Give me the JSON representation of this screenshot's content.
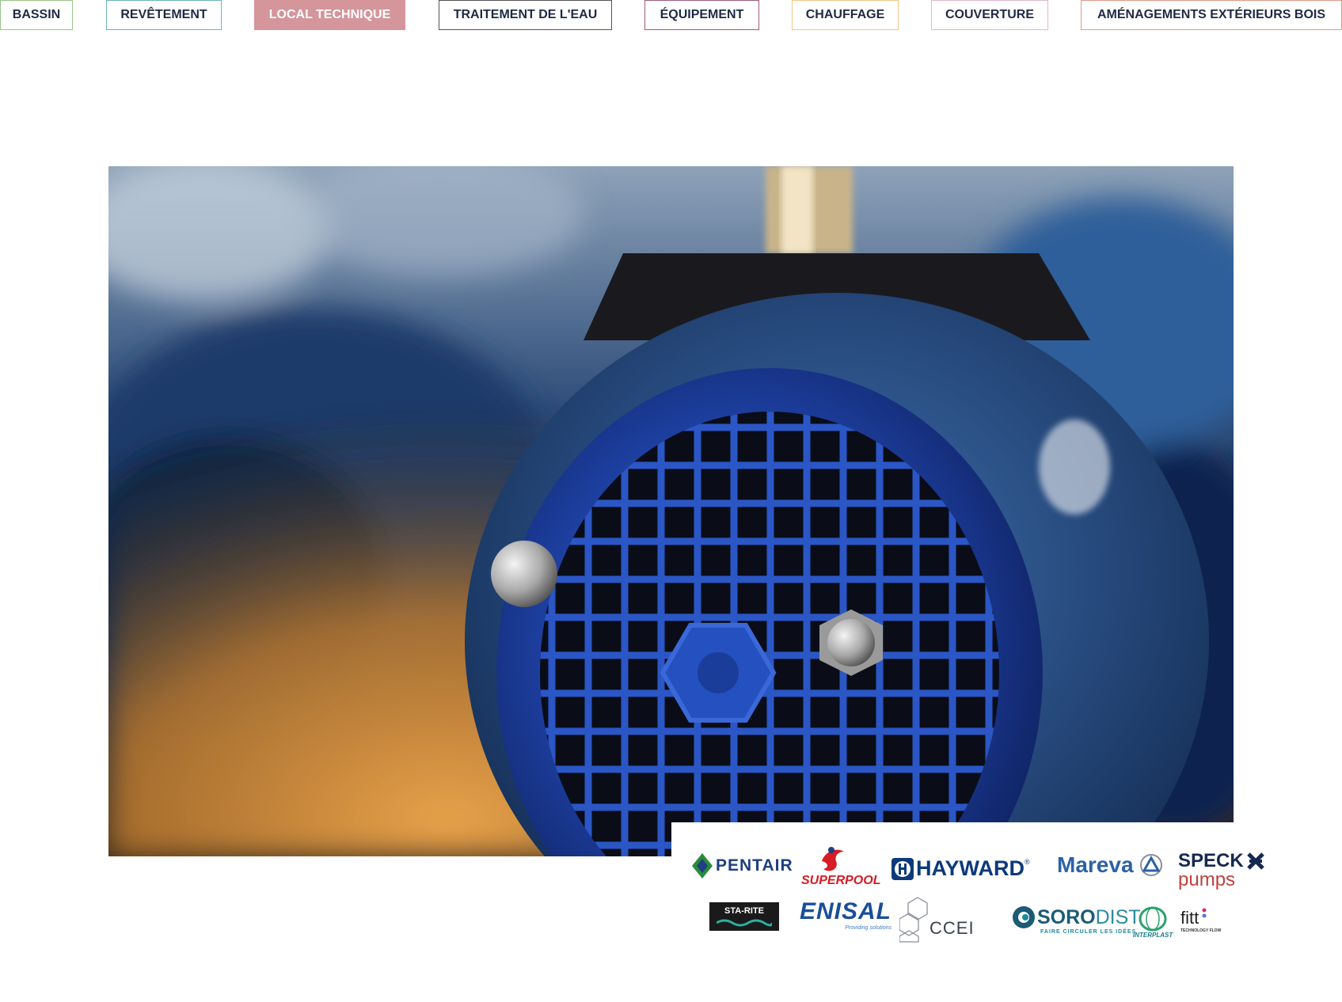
{
  "nav": {
    "tabs": [
      {
        "label": "BASSIN",
        "color": "#9ac48a",
        "active": false
      },
      {
        "label": "REVÊTEMENT",
        "color": "#6ab6c0",
        "active": false
      },
      {
        "label": "LOCAL TECHNIQUE",
        "color": "#d4959b",
        "active": true
      },
      {
        "label": "TRAITEMENT DE L'EAU",
        "color": "#555555",
        "active": false
      },
      {
        "label": "ÉQUIPEMENT",
        "color": "#a05a7a",
        "active": false
      },
      {
        "label": "CHAUFFAGE",
        "color": "#f0c888",
        "active": false
      },
      {
        "label": "COUVERTURE",
        "color": "#e0b8c8",
        "active": false
      },
      {
        "label": "AMÉNAGEMENTS EXTÉRIEURS BOIS",
        "color": "#e09a8a",
        "active": false
      }
    ]
  },
  "hero": {
    "subject": "pump-motor-photo"
  },
  "brands": {
    "pentair": "PENTAIR",
    "superpool": "SUPERPOOL",
    "hayward": "HAYWARD",
    "hayward_reg": "®",
    "mareva": "Mareva",
    "speck": "SPECK",
    "speck_sub": "pumps",
    "starite": "STA-RITE",
    "enisal": "ENISAL",
    "enisal_tag": "Providing solutions",
    "ccei": "CCEI",
    "sorodist_bold": "SORO",
    "sorodist_light": "DIST",
    "sorodist_tag": "FAIRE CIRCULER LES IDÉES",
    "interplast": "INTERPLAST",
    "fitt": "fitt",
    "fitt_tag": "TECHNOLOGY FLOW"
  },
  "colors": {
    "text_dark": "#1f2a44",
    "motor_blue": "#1f45a8"
  }
}
